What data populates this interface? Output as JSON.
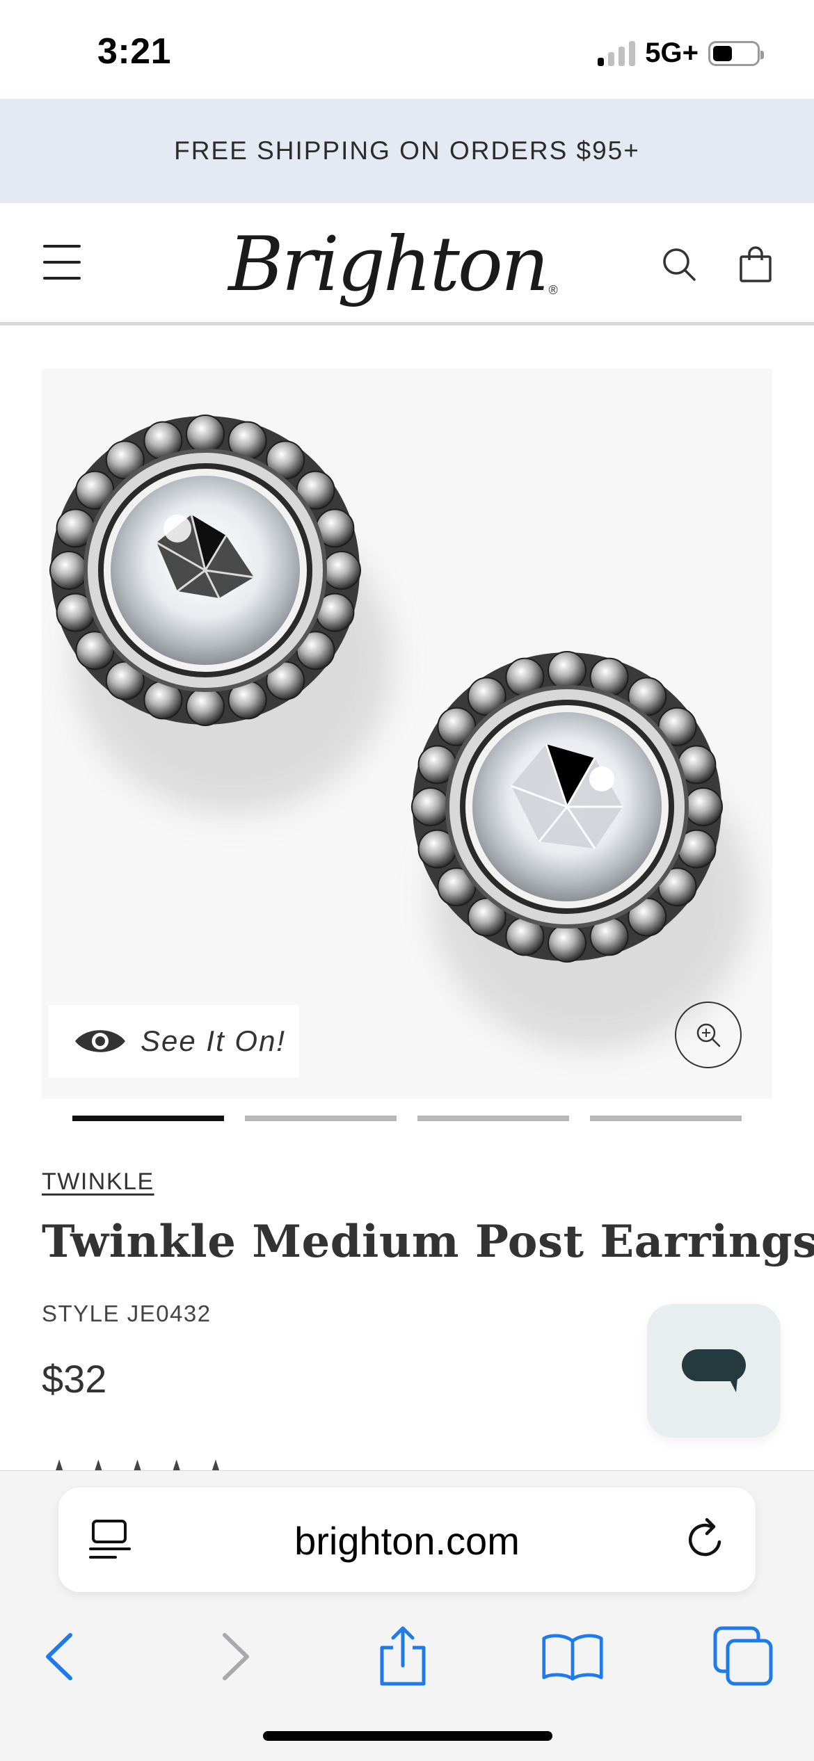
{
  "status_bar": {
    "time": "3:21",
    "network": "5G+",
    "signal_bars": 4,
    "signal_bars_active": 1,
    "battery_level": 0.45
  },
  "promo": {
    "text": "FREE SHIPPING ON ORDERS $95+",
    "background": "#e4e9f3"
  },
  "header": {
    "logo_text": "Brighton",
    "logo_mark": "®",
    "icons": [
      "hamburger-menu-icon",
      "search-icon",
      "shopping-bag-icon"
    ]
  },
  "gallery": {
    "see_it_on_label": "See It On!",
    "see_it_on_icon": "eye-icon",
    "zoom_icon": "zoom-in-icon",
    "slide_count": 4,
    "active_slide": 1
  },
  "product": {
    "collection": "TWINKLE",
    "title": "Twinkle Medium Post Earrings",
    "style": "STYLE JE0432",
    "price": "$32"
  },
  "chat": {
    "icon": "chat-bubble-icon"
  },
  "browser": {
    "url": "brighton.com",
    "accent": "#1f7aeb",
    "toolbar_icons": [
      "back-icon",
      "forward-icon",
      "share-icon",
      "bookmarks-icon",
      "tabs-icon"
    ]
  }
}
